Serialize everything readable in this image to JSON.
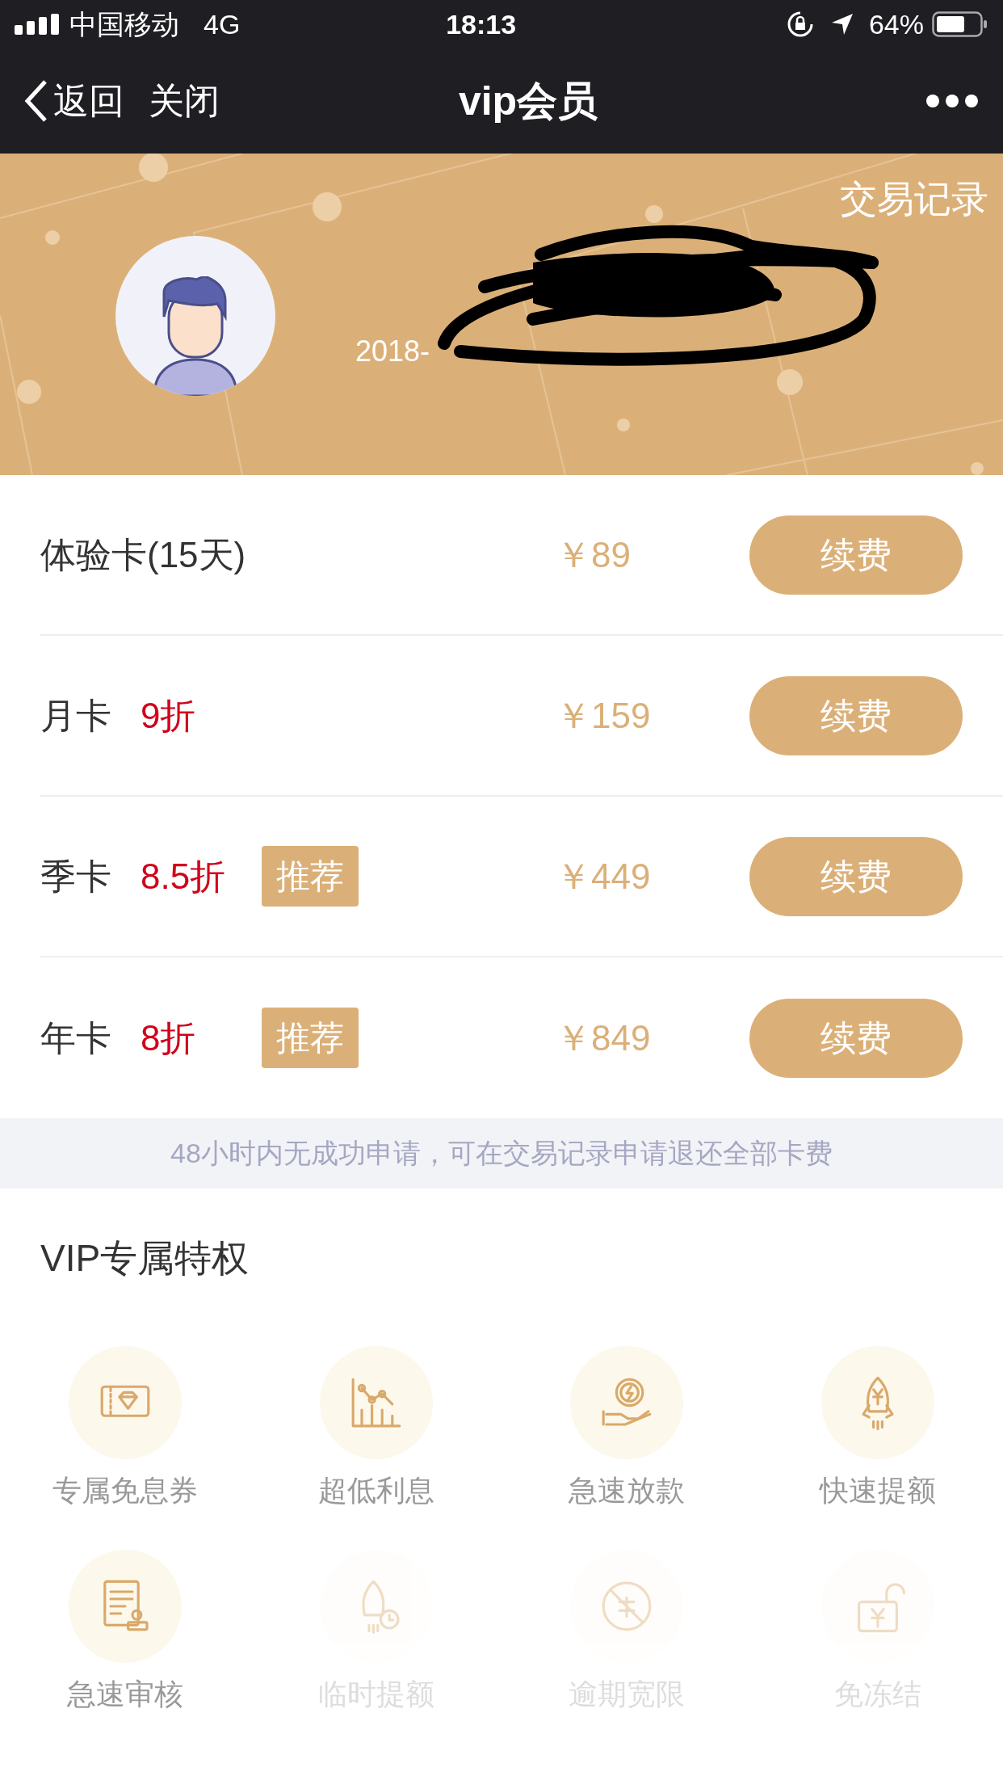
{
  "status_bar": {
    "carrier": "中国移动",
    "network": "4G",
    "time": "18:13",
    "battery": "64%"
  },
  "nav": {
    "back": "返回",
    "close": "关闭",
    "title": "vip会员"
  },
  "banner": {
    "link": "交易记录",
    "date_fragment": "2018-"
  },
  "plans": [
    {
      "name": "体验卡(15天)",
      "price": "￥89",
      "button": "续费"
    },
    {
      "name": "月卡",
      "discount": "9折",
      "price": "￥159",
      "button": "续费"
    },
    {
      "name": "季卡",
      "discount": "8.5折",
      "badge": "推荐",
      "price": "￥449",
      "button": "续费"
    },
    {
      "name": "年卡",
      "discount": "8折",
      "badge": "推荐",
      "price": "￥849",
      "button": "续费"
    }
  ],
  "notice": "48小时内无成功申请，可在交易记录申请退还全部卡费",
  "perks_title": "VIP专属特权",
  "perks": [
    {
      "kind": "ticket",
      "label": "专属免息券",
      "enabled": true
    },
    {
      "kind": "chart",
      "label": "超低利息",
      "enabled": true
    },
    {
      "kind": "coin",
      "label": "急速放款",
      "enabled": true
    },
    {
      "kind": "rocket",
      "label": "快速提额",
      "enabled": true
    },
    {
      "kind": "document",
      "label": "急速审核",
      "enabled": true
    },
    {
      "kind": "rocket-clock",
      "label": "临时提额",
      "enabled": false
    },
    {
      "kind": "forbidden",
      "label": "逾期宽限",
      "enabled": false
    },
    {
      "kind": "lock",
      "label": "免冻结",
      "enabled": false
    }
  ]
}
